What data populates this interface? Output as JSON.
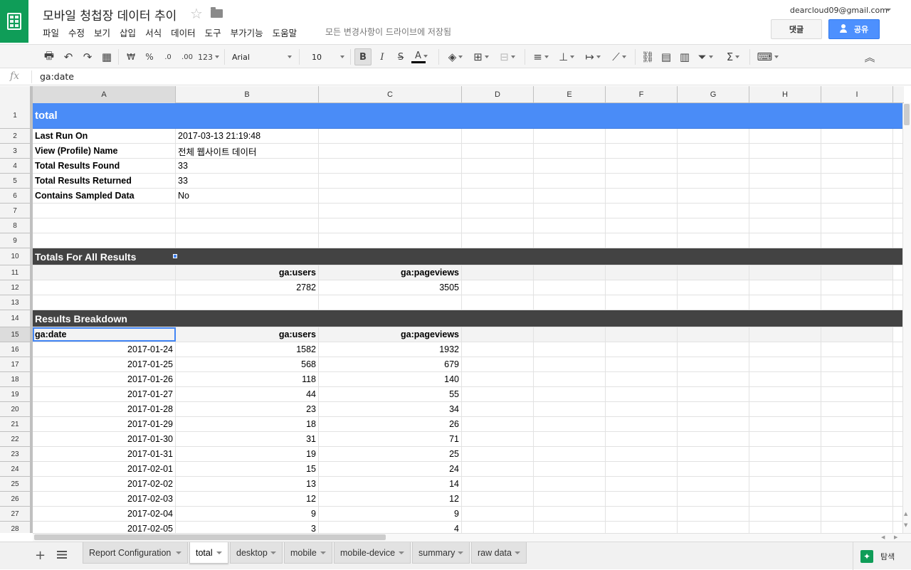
{
  "app": {
    "doc_title": "모바일 청첩장 데이터 추이",
    "save_status": "모든 변경사항이 드라이브에 저장됨",
    "account": "dearcloud09@gmail.com",
    "comment_label": "댓글",
    "share_label": "공유",
    "brand_color": "#0f9d58",
    "share_color": "#4d90fe"
  },
  "menu": [
    "파일",
    "수정",
    "보기",
    "삽입",
    "서식",
    "데이터",
    "도구",
    "부가기능",
    "도움말"
  ],
  "toolbar": {
    "number_format_label": "123",
    "currency": "₩",
    "percent": "%",
    "dec_decrease": ".0",
    "dec_increase": ".00",
    "font": "Arial",
    "font_size": "10",
    "bold": "B",
    "italic": "I",
    "strike": "S",
    "text_color": "A",
    "sum": "Σ"
  },
  "formula_bar": {
    "fx": "fx",
    "value": "ga:date"
  },
  "columns": [
    "A",
    "B",
    "C",
    "D",
    "E",
    "F",
    "G",
    "H",
    "I"
  ],
  "active_cell": "A15",
  "rows": [
    {
      "n": "1",
      "type": "title",
      "cells": [
        "total",
        "",
        ""
      ]
    },
    {
      "n": "2",
      "type": "meta",
      "cells": [
        "Last Run On",
        "2017-03-13 21:19:48",
        ""
      ]
    },
    {
      "n": "3",
      "type": "meta",
      "cells": [
        "View (Profile) Name",
        "전체 웹사이트 데이터",
        ""
      ]
    },
    {
      "n": "4",
      "type": "meta",
      "cells": [
        "Total Results Found",
        "33",
        ""
      ]
    },
    {
      "n": "5",
      "type": "meta",
      "cells": [
        "Total Results Returned",
        "33",
        ""
      ]
    },
    {
      "n": "6",
      "type": "meta",
      "cells": [
        "Contains Sampled Data",
        "No",
        ""
      ]
    },
    {
      "n": "7",
      "type": "blank",
      "cells": [
        "",
        "",
        ""
      ]
    },
    {
      "n": "8",
      "type": "blank",
      "cells": [
        "",
        "",
        ""
      ]
    },
    {
      "n": "9",
      "type": "blank",
      "cells": [
        "",
        "",
        ""
      ]
    },
    {
      "n": "10",
      "type": "section",
      "cells": [
        "Totals For All Results",
        "",
        ""
      ]
    },
    {
      "n": "11",
      "type": "hdr",
      "cells": [
        "",
        "ga:users",
        "ga:pageviews"
      ]
    },
    {
      "n": "12",
      "type": "data",
      "cells": [
        "",
        "2782",
        "3505"
      ]
    },
    {
      "n": "13",
      "type": "blank",
      "cells": [
        "",
        "",
        ""
      ]
    },
    {
      "n": "14",
      "type": "section",
      "cells": [
        "Results Breakdown",
        "",
        ""
      ]
    },
    {
      "n": "15",
      "type": "hdr",
      "cells": [
        "ga:date",
        "ga:users",
        "ga:pageviews"
      ]
    },
    {
      "n": "16",
      "type": "data",
      "cells": [
        "2017-01-24",
        "1582",
        "1932"
      ]
    },
    {
      "n": "17",
      "type": "data",
      "cells": [
        "2017-01-25",
        "568",
        "679"
      ]
    },
    {
      "n": "18",
      "type": "data",
      "cells": [
        "2017-01-26",
        "118",
        "140"
      ]
    },
    {
      "n": "19",
      "type": "data",
      "cells": [
        "2017-01-27",
        "44",
        "55"
      ]
    },
    {
      "n": "20",
      "type": "data",
      "cells": [
        "2017-01-28",
        "23",
        "34"
      ]
    },
    {
      "n": "21",
      "type": "data",
      "cells": [
        "2017-01-29",
        "18",
        "26"
      ]
    },
    {
      "n": "22",
      "type": "data",
      "cells": [
        "2017-01-30",
        "31",
        "71"
      ]
    },
    {
      "n": "23",
      "type": "data",
      "cells": [
        "2017-01-31",
        "19",
        "25"
      ]
    },
    {
      "n": "24",
      "type": "data",
      "cells": [
        "2017-02-01",
        "15",
        "24"
      ]
    },
    {
      "n": "25",
      "type": "data",
      "cells": [
        "2017-02-02",
        "13",
        "14"
      ]
    },
    {
      "n": "26",
      "type": "data",
      "cells": [
        "2017-02-03",
        "12",
        "12"
      ]
    },
    {
      "n": "27",
      "type": "data",
      "cells": [
        "2017-02-04",
        "9",
        "9"
      ]
    },
    {
      "n": "28",
      "type": "data",
      "cells": [
        "2017-02-05",
        "3",
        "4"
      ]
    }
  ],
  "sheet_tabs": [
    "Report Configuration",
    "total",
    "desktop",
    "mobile",
    "mobile-device",
    "summary",
    "raw data"
  ],
  "active_tab": "total",
  "explore_label": "탐색"
}
